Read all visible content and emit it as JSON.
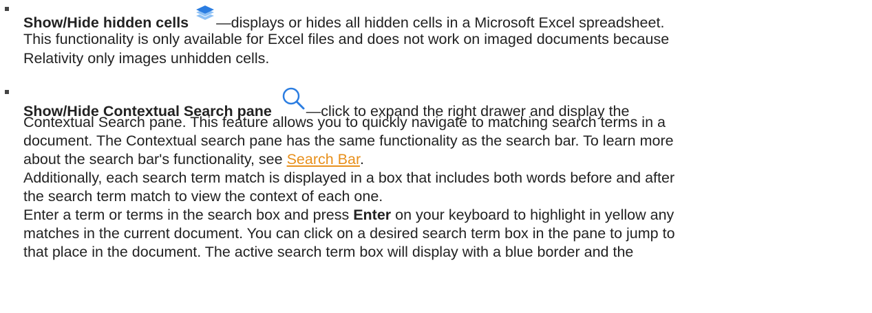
{
  "items": [
    {
      "title": "Show/Hide hidden cells",
      "icon": "layers-icon",
      "lines": [
        "—displays or hides all hidden cells in a Microsoft Excel spreadsheet.",
        "This functionality is only available for Excel files and does not work on imaged documents because",
        "Relativity only images unhidden cells."
      ]
    },
    {
      "title": "Show/Hide Contextual Search pane",
      "icon": "search-icon",
      "lines": [
        "—click to expand the right drawer and display the",
        "Contextual Search pane. This feature allows you to quickly navigate to matching search terms in a",
        "document. The Contextual search pane has the same functionality as the search bar. To learn more",
        "about the search bar's functionality, see ",
        "Search Bar",
        ".",
        "Additionally, each search term match is displayed in a box that includes both words before and after",
        "the search term match to view the context of each one.",
        "Enter a term or terms in the search box and press ",
        "Enter",
        " on your keyboard to highlight in yellow any",
        "matches in the current document. You can click on a desired search term box in the pane to jump to",
        "that place in the document. The active search term box will display with a blue border and the"
      ]
    }
  ],
  "colors": {
    "text": "#222222",
    "link": "#e8901c",
    "icon_blue": "#2b7de1",
    "icon_blue_light": "#8ec1f5",
    "bullet": "#444444"
  }
}
